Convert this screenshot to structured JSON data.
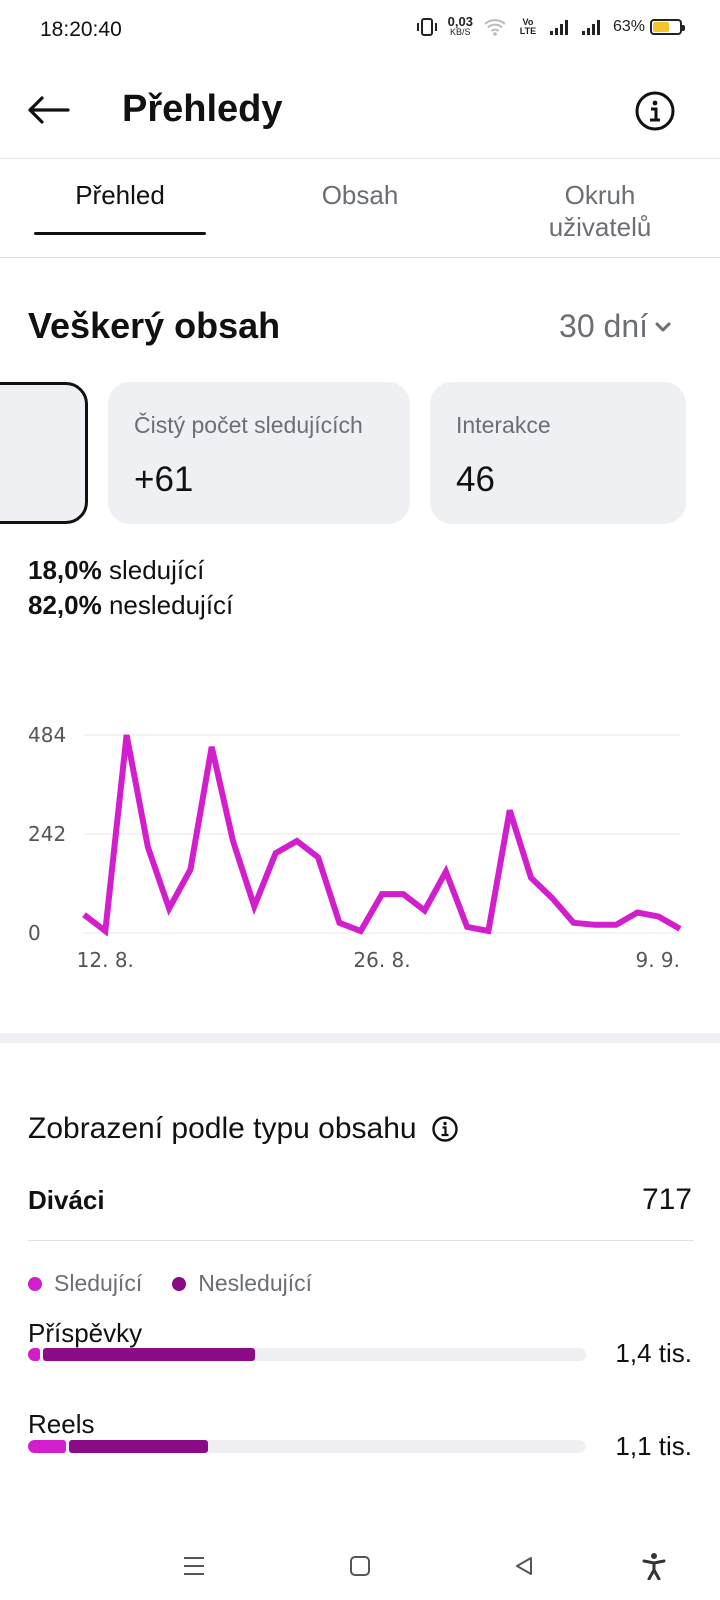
{
  "status_bar": {
    "time": "18:20:40",
    "net_speed": "0,03",
    "net_unit": "KB/S",
    "volte": "Vo LTE",
    "battery": "63%",
    "battery_level": 0.63
  },
  "header": {
    "title": "Přehledy"
  },
  "tabs": [
    {
      "label": "Přehled",
      "active": true
    },
    {
      "label": "Obsah",
      "active": false
    },
    {
      "label": "Okruh uživatelů",
      "active": false
    }
  ],
  "section": {
    "title": "Veškerý obsah",
    "range": "30 dní"
  },
  "cards": [
    {
      "label": "Čistý počet sledujících",
      "value": "+61"
    },
    {
      "label": "Interakce",
      "value": "46"
    }
  ],
  "audience_split": [
    {
      "value": "18,0%",
      "label": "sledující"
    },
    {
      "value": "82,0%",
      "label": "nesledující"
    }
  ],
  "chart_data": {
    "type": "line",
    "color": "#d21ecc",
    "y_ticks": [
      "484",
      "242",
      "0"
    ],
    "ylim": [
      0,
      484
    ],
    "x_ticks": [
      "12. 8.",
      "26. 8.",
      "9. 9."
    ],
    "x_tick_positions": [
      1,
      14,
      28
    ],
    "values": [
      45,
      5,
      484,
      210,
      60,
      155,
      455,
      225,
      65,
      195,
      225,
      185,
      25,
      5,
      95,
      95,
      55,
      150,
      15,
      5,
      300,
      135,
      85,
      25,
      20,
      20,
      50,
      40,
      10
    ]
  },
  "views": {
    "title": "Zobrazení podle typu obsahu",
    "viewers_label": "Diváci",
    "viewers_value": "717",
    "legend": [
      {
        "label": "Sledující",
        "color": "#d21ecc"
      },
      {
        "label": "Nesledující",
        "color": "#8b0a86"
      }
    ],
    "rows": [
      {
        "label": "Příspěvky",
        "value": "1,4 tis.",
        "followers": 0.022,
        "non_followers": 0.38
      },
      {
        "label": "Reels",
        "value": "1,1 tis.",
        "followers": 0.068,
        "non_followers": 0.25
      }
    ]
  }
}
